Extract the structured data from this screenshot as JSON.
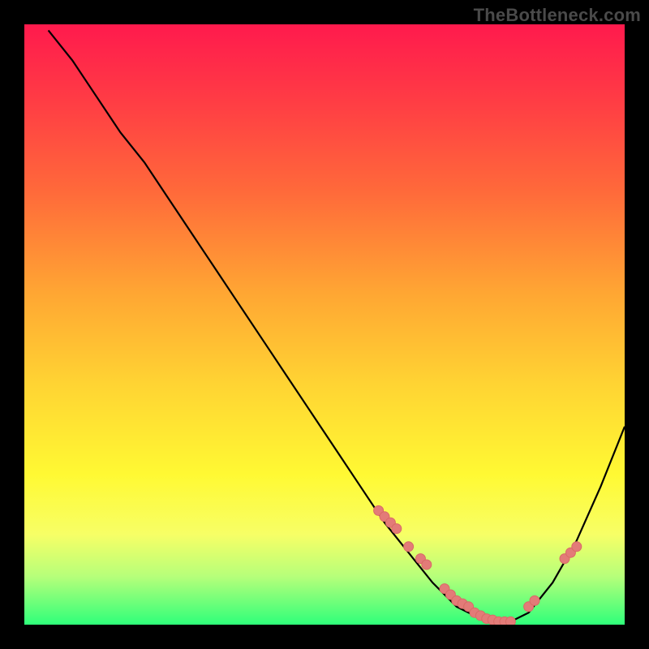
{
  "watermark": "TheBottleneck.com",
  "colors": {
    "background": "#000000",
    "curve": "#000000",
    "marker_fill": "#e37b78",
    "marker_stroke": "#d96a66",
    "gradient_top": "#ff1a4d",
    "gradient_bottom": "#2fff7a"
  },
  "chart_data": {
    "type": "line",
    "title": "",
    "xlabel": "",
    "ylabel": "",
    "xlim": [
      0,
      100
    ],
    "ylim": [
      0,
      100
    ],
    "grid": false,
    "x": [
      4,
      8,
      12,
      16,
      20,
      24,
      28,
      32,
      36,
      40,
      44,
      48,
      52,
      56,
      60,
      64,
      68,
      72,
      76,
      80,
      84,
      88,
      92,
      96,
      100
    ],
    "values": [
      99,
      94,
      88,
      82,
      77,
      71,
      65,
      59,
      53,
      47,
      41,
      35,
      29,
      23,
      17,
      12,
      7,
      3,
      1,
      0,
      2,
      7,
      14,
      23,
      33
    ],
    "series": [
      {
        "name": "markers-cluster-left",
        "x": [
          59,
          60,
          61,
          62,
          64,
          66,
          67,
          70,
          71,
          72,
          73,
          74,
          75,
          76,
          77,
          78,
          79,
          80,
          81
        ],
        "y": [
          19,
          18,
          17,
          16,
          13,
          11,
          10,
          6,
          5,
          4,
          3.5,
          3,
          2,
          1.5,
          1,
          0.8,
          0.5,
          0.5,
          0.5
        ]
      },
      {
        "name": "markers-cluster-right",
        "x": [
          84,
          85,
          90,
          91,
          92
        ],
        "y": [
          3,
          4,
          11,
          12,
          13
        ]
      }
    ]
  }
}
